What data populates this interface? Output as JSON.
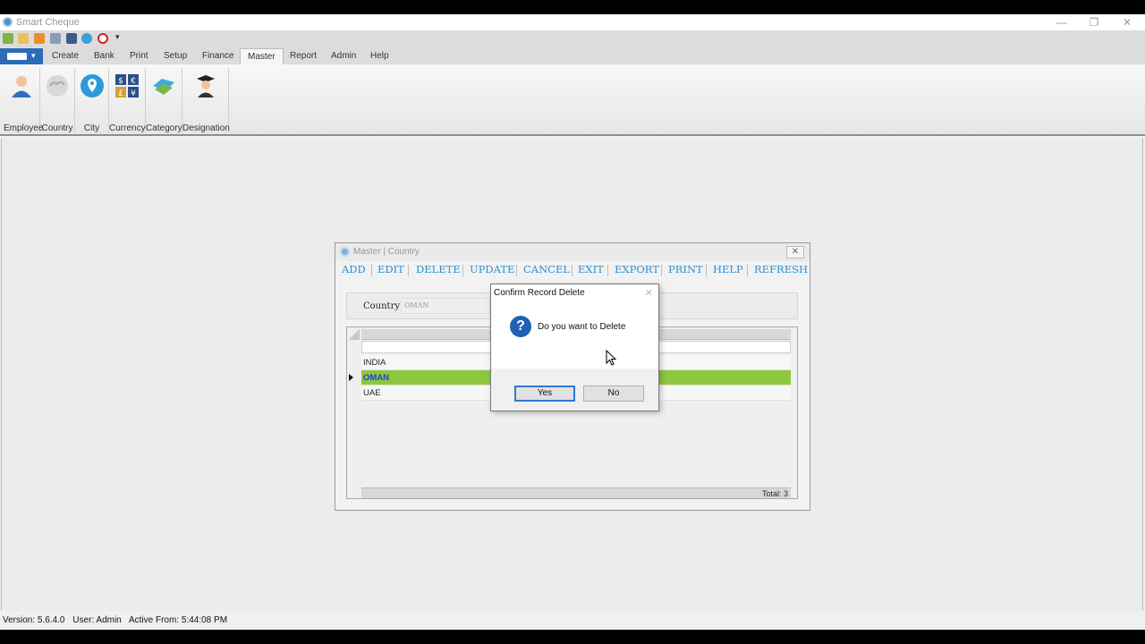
{
  "app": {
    "title": "Smart Cheque",
    "window_controls": {
      "minimize": "—",
      "restore": "❐",
      "close": "✕"
    }
  },
  "quick_access": {
    "icons": [
      "new-icon",
      "open-icon",
      "mail-icon",
      "print-icon",
      "settings-icon",
      "refresh-icon",
      "power-icon"
    ],
    "customize": "▾"
  },
  "ribbon": {
    "app_menu_arrow": "▾",
    "tabs": [
      "Create",
      "Bank",
      "Print",
      "Setup",
      "Finance",
      "Master",
      "Report",
      "Admin",
      "Help"
    ],
    "active_tab": "Master",
    "buttons": [
      {
        "label": "Employee",
        "icon": "employee-icon"
      },
      {
        "label": "Country",
        "icon": "globe-icon"
      },
      {
        "label": "City",
        "icon": "map-pin-icon"
      },
      {
        "label": "Currency",
        "icon": "currency-icon"
      },
      {
        "label": "Category",
        "icon": "category-icon"
      },
      {
        "label": "Designation",
        "icon": "graduate-icon"
      }
    ]
  },
  "master_window": {
    "title": "Master | Country",
    "close": "✕",
    "menu": [
      "ADD",
      "EDIT",
      "DELETE",
      "UPDATE",
      "CANCEL",
      "EXIT",
      "EXPORT",
      "PRINT",
      "HELP",
      "REFRESH"
    ],
    "country_label": "Country",
    "country_value": "OMAN",
    "rows": [
      "INDIA",
      "OMAN",
      "UAE"
    ],
    "selected_row": "OMAN",
    "total": "Total: 3"
  },
  "dialog": {
    "title": "Confirm Record Delete",
    "close": "✕",
    "icon": "?",
    "message": "Do you want to Delete",
    "yes": "Yes",
    "no": "No"
  },
  "status": {
    "version": "Version:  5.6.4.0",
    "user": "User:  Admin",
    "active_from": "Active From:  5:44:08 PM"
  },
  "colors": {
    "accent_blue": "#2d8fd0",
    "selected_row": "#8dc63f",
    "app_menu": "#2b6cb8"
  }
}
